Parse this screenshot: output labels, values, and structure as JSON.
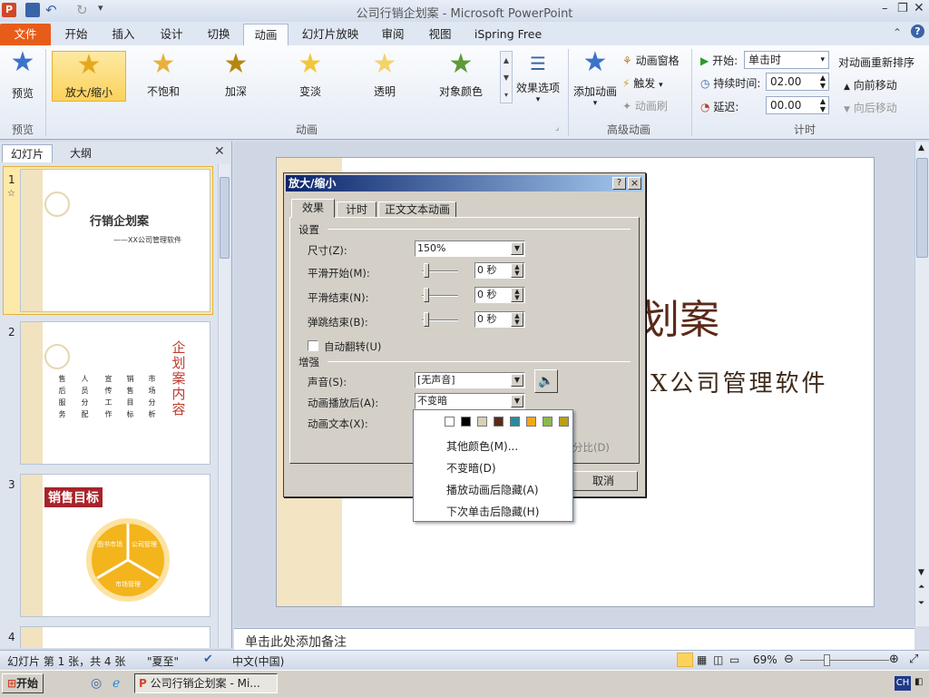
{
  "window": {
    "title": "公司行销企划案 - Microsoft PowerPoint"
  },
  "tabs": [
    "文件",
    "开始",
    "插入",
    "设计",
    "切换",
    "动画",
    "幻灯片放映",
    "审阅",
    "视图",
    "iSpring Free"
  ],
  "ribbon": {
    "preview_label": "预览",
    "preview_group": "预览",
    "effects": [
      "放大/缩小",
      "不饱和",
      "加深",
      "变淡",
      "透明",
      "对象颜色"
    ],
    "anim_group": "动画",
    "effect_options": "效果选项",
    "add_anim": "添加动画",
    "anim_pane": "动画窗格",
    "trigger": "触发",
    "anim_painter": "动画刷",
    "adv_group": "高级动画",
    "start_label": "开始:",
    "start_value": "单击时",
    "duration_label": "持续时间:",
    "duration_value": "02.00",
    "delay_label": "延迟:",
    "delay_value": "00.00",
    "timing_group": "计时",
    "reorder_title": "对动画重新排序",
    "move_earlier": "向前移动",
    "move_later": "向后移动"
  },
  "left_panel": {
    "tab_slides": "幻灯片",
    "tab_outline": "大纲",
    "slide1_title": "行销企划案",
    "slide1_sub": "——XX公司管理软件",
    "slide2_title": "企划案内容",
    "slide2_cols": [
      "市场分析",
      "销售目标",
      "宣传工作",
      "人员分配",
      "售后服务"
    ],
    "slide3_title": "销售目标",
    "slide3_seg1": "图书市场",
    "slide3_seg2": "公司管理",
    "slide3_seg3": "市场管理",
    "nums": [
      "1",
      "2",
      "3",
      "4"
    ]
  },
  "slide": {
    "title_frag": "划案",
    "sub_frag": "X公司管理软件"
  },
  "dialog": {
    "title": "放大/缩小",
    "help": "?",
    "close": "×",
    "tabs": [
      "效果",
      "计时",
      "正文文本动画"
    ],
    "section_settings": "设置",
    "size_label": "尺寸(Z):",
    "size_value": "150%",
    "smooth_start_label": "平滑开始(M):",
    "smooth_start_value": "0 秒",
    "smooth_end_label": "平滑结束(N):",
    "smooth_end_value": "0 秒",
    "bounce_label": "弹跳结束(B):",
    "bounce_value": "0 秒",
    "auto_reverse": "自动翻转(U)",
    "section_enhance": "增强",
    "sound_label": "声音(S):",
    "sound_value": "[无声音]",
    "after_label": "动画播放后(A):",
    "after_value": "不变暗",
    "text_label": "动画文本(X):",
    "hidden_frag": "分比(D)",
    "cancel": "取消"
  },
  "popup": {
    "swatches": [
      "#ffffff",
      "#000000",
      "#d9cfb8",
      "#5a2a1a",
      "#2a8aa0",
      "#f0a818",
      "#8ab850",
      "#b8a018"
    ],
    "items": [
      "其他颜色(M)...",
      "不变暗(D)",
      "播放动画后隐藏(A)",
      "下次单击后隐藏(H)"
    ]
  },
  "notes": {
    "placeholder": "单击此处添加备注"
  },
  "status": {
    "slide_info": "幻灯片 第 1 张，共 4 张",
    "theme": "\"夏至\"",
    "language": "中文(中国)",
    "zoom": "69%"
  },
  "taskbar": {
    "start": "开始",
    "app": "公司行销企划案 - Mi...",
    "ime": "CH"
  }
}
